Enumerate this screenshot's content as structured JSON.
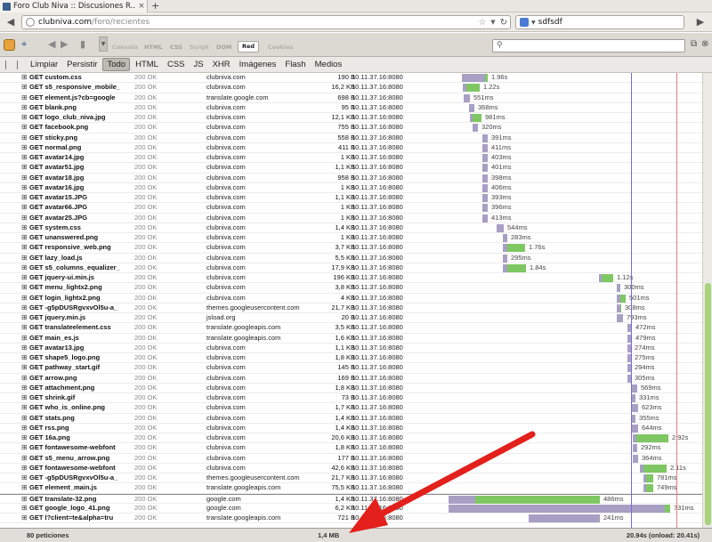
{
  "browser": {
    "tab_title": "Foro Club Niva :: Discusiones R...",
    "tab_close": "×",
    "new_tab": "+",
    "url_host": "clubniva.com",
    "url_path": "/foro/recientes",
    "search_query": "sdfsdf",
    "back": "◀",
    "forward": "▶"
  },
  "firebug": {
    "tabs": [
      "Consola",
      "HTML",
      "CSS",
      "Script",
      "DOM",
      "Cookies"
    ],
    "net_tab": "Red"
  },
  "filters": [
    "Limpiar",
    "Persistir",
    "Todo",
    "HTML",
    "CSS",
    "JS",
    "XHR",
    "Imágenes",
    "Flash",
    "Medios"
  ],
  "active_filter": "Todo",
  "colors": {
    "waiting": "#a79fc4",
    "receiving": "#7ec763",
    "annotation": "#e3201b",
    "dom_line": "#7b6ad6",
    "load_line": "#e77b7b"
  },
  "requests": [
    {
      "url": "GET custom.css",
      "status": "200 OK",
      "domain": "clubniva.com",
      "size": "190 B",
      "ip": "10.11.37.16:8080",
      "time": "1.96s",
      "start": 22,
      "wait": 26,
      "recv": 3
    },
    {
      "url": "GET s5_responsive_mobile_",
      "status": "200 OK",
      "domain": "clubniva.com",
      "size": "16,2 KB",
      "ip": "10.11.37.16:8080",
      "time": "1.22s",
      "start": 23,
      "wait": 4,
      "recv": 15
    },
    {
      "url": "GET element.js?cb=google",
      "status": "200 OK",
      "domain": "translate.google.com",
      "size": "698 B",
      "ip": "10.11.37.16:8080",
      "time": "551ms",
      "start": 24,
      "wait": 7,
      "recv": 0
    },
    {
      "url": "GET blank.png",
      "status": "200 OK",
      "domain": "clubniva.com",
      "size": "95 B",
      "ip": "10.11.37.16:8080",
      "time": "368ms",
      "start": 30,
      "wait": 6,
      "recv": 0
    },
    {
      "url": "GET logo_club_niva.jpg",
      "status": "200 OK",
      "domain": "clubniva.com",
      "size": "12,1 KB",
      "ip": "10.11.37.16:8080",
      "time": "981ms",
      "start": 31,
      "wait": 3,
      "recv": 10
    },
    {
      "url": "GET facebook.png",
      "status": "200 OK",
      "domain": "clubniva.com",
      "size": "755 B",
      "ip": "10.11.37.16:8080",
      "time": "320ms",
      "start": 34,
      "wait": 6,
      "recv": 0
    },
    {
      "url": "GET sticky.png",
      "status": "200 OK",
      "domain": "clubniva.com",
      "size": "558 B",
      "ip": "10.11.37.16:8080",
      "time": "391ms",
      "start": 45,
      "wait": 6,
      "recv": 0
    },
    {
      "url": "GET normal.png",
      "status": "200 OK",
      "domain": "clubniva.com",
      "size": "411 B",
      "ip": "10.11.37.16:8080",
      "time": "411ms",
      "start": 45,
      "wait": 6,
      "recv": 0
    },
    {
      "url": "GET avatar14.jpg",
      "status": "200 OK",
      "domain": "clubniva.com",
      "size": "1 KB",
      "ip": "10.11.37.16:8080",
      "time": "403ms",
      "start": 45,
      "wait": 6,
      "recv": 0
    },
    {
      "url": "GET avatar51.jpg",
      "status": "200 OK",
      "domain": "clubniva.com",
      "size": "1,1 KB",
      "ip": "10.11.37.16:8080",
      "time": "401ms",
      "start": 45,
      "wait": 6,
      "recv": 0
    },
    {
      "url": "GET avatar18.jpg",
      "status": "200 OK",
      "domain": "clubniva.com",
      "size": "958 B",
      "ip": "10.11.37.16:8080",
      "time": "398ms",
      "start": 45,
      "wait": 6,
      "recv": 0
    },
    {
      "url": "GET avatar16.jpg",
      "status": "200 OK",
      "domain": "clubniva.com",
      "size": "1 KB",
      "ip": "10.11.37.16:8080",
      "time": "406ms",
      "start": 45,
      "wait": 6,
      "recv": 0
    },
    {
      "url": "GET avatar15.JPG",
      "status": "200 OK",
      "domain": "clubniva.com",
      "size": "1,1 KB",
      "ip": "10.11.37.16:8080",
      "time": "393ms",
      "start": 45,
      "wait": 6,
      "recv": 0
    },
    {
      "url": "GET avatar66.JPG",
      "status": "200 OK",
      "domain": "clubniva.com",
      "size": "1 KB",
      "ip": "10.11.37.16:8080",
      "time": "396ms",
      "start": 45,
      "wait": 6,
      "recv": 0
    },
    {
      "url": "GET avatar25.JPG",
      "status": "200 OK",
      "domain": "clubniva.com",
      "size": "1 KB",
      "ip": "10.11.37.16:8080",
      "time": "413ms",
      "start": 45,
      "wait": 6,
      "recv": 0
    },
    {
      "url": "GET system.css",
      "status": "200 OK",
      "domain": "clubniva.com",
      "size": "1,4 KB",
      "ip": "10.11.37.16:8080",
      "time": "544ms",
      "start": 61,
      "wait": 8,
      "recv": 0
    },
    {
      "url": "GET unanswered.png",
      "status": "200 OK",
      "domain": "clubniva.com",
      "size": "1 KB",
      "ip": "10.11.37.16:8080",
      "time": "283ms",
      "start": 68,
      "wait": 5,
      "recv": 0
    },
    {
      "url": "GET responsive_web.png",
      "status": "200 OK",
      "domain": "clubniva.com",
      "size": "3,7 KB",
      "ip": "10.11.37.16:8080",
      "time": "1.76s",
      "start": 68,
      "wait": 5,
      "recv": 20
    },
    {
      "url": "GET lazy_load.js",
      "status": "200 OK",
      "domain": "clubniva.com",
      "size": "5,5 KB",
      "ip": "10.11.37.16:8080",
      "time": "295ms",
      "start": 68,
      "wait": 5,
      "recv": 0
    },
    {
      "url": "GET s5_columns_equalizer_",
      "status": "200 OK",
      "domain": "clubniva.com",
      "size": "17,9 KB",
      "ip": "10.11.37.16:8080",
      "time": "1.84s",
      "start": 68,
      "wait": 5,
      "recv": 21
    },
    {
      "url": "GET jquery-ui.min.js",
      "status": "200 OK",
      "domain": "clubniva.com",
      "size": "196 KB",
      "ip": "10.11.37.16:8080",
      "time": "1.12s",
      "start": 176,
      "wait": 3,
      "recv": 13
    },
    {
      "url": "GET menu_lightx2.png",
      "status": "200 OK",
      "domain": "clubniva.com",
      "size": "3,8 KB",
      "ip": "10.11.37.16:8080",
      "time": "300ms",
      "start": 196,
      "wait": 4,
      "recv": 0
    },
    {
      "url": "GET login_lightx2.png",
      "status": "200 OK",
      "domain": "clubniva.com",
      "size": "4 KB",
      "ip": "10.11.37.16:8080",
      "time": "501ms",
      "start": 196,
      "wait": 4,
      "recv": 6
    },
    {
      "url": "GET -g5pDUSRgvxvOl5u-a_",
      "status": "200 OK",
      "domain": "themes.googleusercontent.com",
      "size": "21,7 KB",
      "ip": "10.11.37.16:8080",
      "time": "308ms",
      "start": 196,
      "wait": 4,
      "recv": 1
    },
    {
      "url": "GET jquery.min.js",
      "status": "200 OK",
      "domain": "jsload.org",
      "size": "20 B",
      "ip": "10.11.37.16:8080",
      "time": "793ms",
      "start": 196,
      "wait": 7,
      "recv": 0
    },
    {
      "url": "GET translateelement.css",
      "status": "200 OK",
      "domain": "translate.googleapis.com",
      "size": "3,5 KB",
      "ip": "10.11.37.16:8080",
      "time": "472ms",
      "start": 208,
      "wait": 5,
      "recv": 0
    },
    {
      "url": "GET main_es.js",
      "status": "200 OK",
      "domain": "translate.googleapis.com",
      "size": "1,6 KB",
      "ip": "10.11.37.16:8080",
      "time": "479ms",
      "start": 208,
      "wait": 5,
      "recv": 0
    },
    {
      "url": "GET avatar13.jpg",
      "status": "200 OK",
      "domain": "clubniva.com",
      "size": "1,1 KB",
      "ip": "10.11.37.16:8080",
      "time": "274ms",
      "start": 208,
      "wait": 4,
      "recv": 0
    },
    {
      "url": "GET shape5_logo.png",
      "status": "200 OK",
      "domain": "clubniva.com",
      "size": "1,8 KB",
      "ip": "10.11.37.16:8080",
      "time": "275ms",
      "start": 208,
      "wait": 4,
      "recv": 0
    },
    {
      "url": "GET pathway_start.gif",
      "status": "200 OK",
      "domain": "clubniva.com",
      "size": "145 B",
      "ip": "10.11.37.16:8080",
      "time": "294ms",
      "start": 208,
      "wait": 4,
      "recv": 0
    },
    {
      "url": "GET arrow.png",
      "status": "200 OK",
      "domain": "clubniva.com",
      "size": "169 B",
      "ip": "10.11.37.16:8080",
      "time": "305ms",
      "start": 208,
      "wait": 4,
      "recv": 0
    },
    {
      "url": "GET attachment.png",
      "status": "200 OK",
      "domain": "clubniva.com",
      "size": "1,8 KB",
      "ip": "10.11.37.16:8080",
      "time": "569ms",
      "start": 212,
      "wait": 7,
      "recv": 0
    },
    {
      "url": "GET shrink.gif",
      "status": "200 OK",
      "domain": "clubniva.com",
      "size": "73 B",
      "ip": "10.11.37.16:8080",
      "time": "331ms",
      "start": 212,
      "wait": 5,
      "recv": 0
    },
    {
      "url": "GET who_is_online.png",
      "status": "200 OK",
      "domain": "clubniva.com",
      "size": "1,7 KB",
      "ip": "10.11.37.16:8080",
      "time": "623ms",
      "start": 212,
      "wait": 8,
      "recv": 0
    },
    {
      "url": "GET stats.png",
      "status": "200 OK",
      "domain": "clubniva.com",
      "size": "1,4 KB",
      "ip": "10.11.37.16:8080",
      "time": "355ms",
      "start": 212,
      "wait": 5,
      "recv": 0
    },
    {
      "url": "GET rss.png",
      "status": "200 OK",
      "domain": "clubniva.com",
      "size": "1,4 KB",
      "ip": "10.11.37.16:8080",
      "time": "644ms",
      "start": 212,
      "wait": 8,
      "recv": 0
    },
    {
      "url": "GET 16a.png",
      "status": "200 OK",
      "domain": "clubniva.com",
      "size": "20,6 KB",
      "ip": "10.11.37.16:8080",
      "time": "2.92s",
      "start": 214,
      "wait": 4,
      "recv": 36
    },
    {
      "url": "GET fontawesome-webfont",
      "status": "200 OK",
      "domain": "clubniva.com",
      "size": "1,8 KB",
      "ip": "10.11.37.16:8080",
      "time": "292ms",
      "start": 214,
      "wait": 5,
      "recv": 0
    },
    {
      "url": "GET s5_menu_arrow.png",
      "status": "200 OK",
      "domain": "clubniva.com",
      "size": "177 B",
      "ip": "10.11.37.16:8080",
      "time": "364ms",
      "start": 214,
      "wait": 6,
      "recv": 0
    },
    {
      "url": "GET fontawesome-webfont",
      "status": "200 OK",
      "domain": "clubniva.com",
      "size": "42,6 KB",
      "ip": "10.11.37.16:8080",
      "time": "2.11s",
      "start": 222,
      "wait": 4,
      "recv": 26
    },
    {
      "url": "GET -g5pDUSRgvxvOl5u-a_",
      "status": "200 OK",
      "domain": "themes.googleusercontent.com",
      "size": "21,7 KB",
      "ip": "10.11.37.16:8080",
      "time": "781ms",
      "start": 226,
      "wait": 3,
      "recv": 8
    },
    {
      "url": "GET element_main.js",
      "status": "200 OK",
      "domain": "translate.googleapis.com",
      "size": "75,5 KB",
      "ip": "10.11.37.16:8080",
      "time": "749ms",
      "start": 226,
      "wait": 3,
      "recv": 8
    },
    {
      "url": "GET translate-32.png",
      "status": "200 OK",
      "domain": "google.com",
      "size": "1,4 KB",
      "ip": "10.11.37.16:8080",
      "time": "486ms",
      "start": 7,
      "wait": 30,
      "recv": 140
    },
    {
      "url": "GET google_logo_41.png",
      "status": "200 OK",
      "domain": "google.com",
      "size": "6,2 KB",
      "ip": "10.11.37.16:8080",
      "time": "731ms",
      "start": 7,
      "wait": 243,
      "recv": 6
    },
    {
      "url": "GET l?client=te&alpha=tru",
      "status": "200 OK",
      "domain": "translate.googleapis.com",
      "size": "721 B",
      "ip": "10.11.37.16:8080",
      "time": "241ms",
      "start": 97,
      "wait": 80,
      "recv": 0
    }
  ],
  "footer": {
    "requests": "80 peticiones",
    "total_size": "1,4 MB",
    "timing": "20.94s (onload: 20.41s)"
  }
}
